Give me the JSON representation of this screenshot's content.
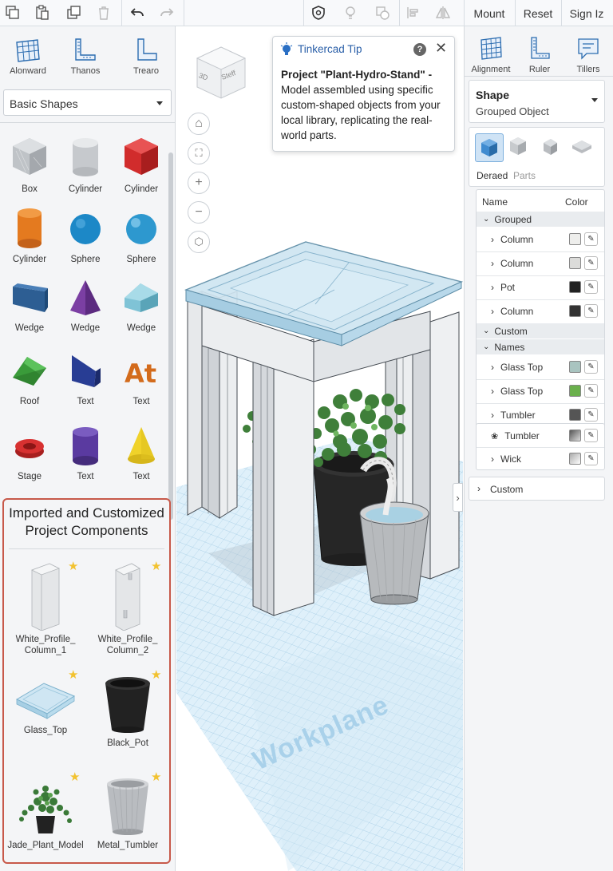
{
  "toolbar": {
    "mount_label": "Mount",
    "reset_label": "Reset",
    "signin_label": "Sign Iz"
  },
  "left_tools": [
    {
      "label": "Alonward",
      "icon": "grid-icon"
    },
    {
      "label": "Thanos",
      "icon": "ruler-icon"
    },
    {
      "label": "Trearo",
      "icon": "ruler-corner-icon"
    }
  ],
  "shapes_dropdown": {
    "selected": "Basic Shapes"
  },
  "shapes": [
    {
      "label": "Box"
    },
    {
      "label": "Cylinder"
    },
    {
      "label": "Cylinder"
    },
    {
      "label": "Cylinder"
    },
    {
      "label": "Sphere"
    },
    {
      "label": "Sphere"
    },
    {
      "label": "Wedge"
    },
    {
      "label": "Wedge"
    },
    {
      "label": "Wedge"
    },
    {
      "label": "Roof"
    },
    {
      "label": "Text"
    },
    {
      "label": "Text"
    },
    {
      "label": "Stage"
    },
    {
      "label": "Text"
    },
    {
      "label": "Text"
    }
  ],
  "imported": {
    "title_line1": "Imported and Customized",
    "title_line2": "Project Components",
    "items": [
      {
        "line1": "White_Profile_",
        "line2": "Column_1"
      },
      {
        "line1": "White_Profile_",
        "line2": "Column_2"
      },
      {
        "line1": "Glass_Top",
        "line2": ""
      },
      {
        "line1": "Black_Pot",
        "line2": ""
      },
      {
        "line1": "Jade_Plant_Model",
        "line2": ""
      },
      {
        "line1": "Metal_Tumbler",
        "line2": ""
      }
    ]
  },
  "viewcube": {
    "face_3d": "3D",
    "face_side": "Steff"
  },
  "tip": {
    "title": "Tinkercad Tip",
    "bold": "Project \"Plant-Hydro-Stand\" -",
    "body": "Model assembled using specific custom-shaped objects from your local library, replicating the real-world parts."
  },
  "workplane_label": "Workplane",
  "right_tools": [
    {
      "label": "Alignment"
    },
    {
      "label": "Ruler"
    },
    {
      "label": "Tillers"
    }
  ],
  "shape_panel": {
    "title": "Shape",
    "subtitle": "Grouped Object"
  },
  "view_tabs": {
    "active": "Deraed",
    "other": "Parts"
  },
  "tree": {
    "col_name": "Name",
    "col_color": "Color",
    "group1": "Grouped",
    "group1_items": [
      {
        "label": "Column",
        "color": "#eeeeec"
      },
      {
        "label": "Column",
        "color": "#dcdcda"
      },
      {
        "label": "Pot",
        "color": "#222222"
      },
      {
        "label": "Column",
        "color": "#333333"
      }
    ],
    "group2": "Custom",
    "group3": "Names",
    "group3_items": [
      {
        "label": "Glass Top",
        "color": "#a9c4c0"
      },
      {
        "label": "Glass Top",
        "color": "#6ab04c"
      },
      {
        "label": "Tumbler",
        "color": "#555555"
      }
    ],
    "extra_items": [
      {
        "label": "Tumbler"
      },
      {
        "label": "Wick"
      }
    ],
    "custom_footer": "Custom"
  }
}
